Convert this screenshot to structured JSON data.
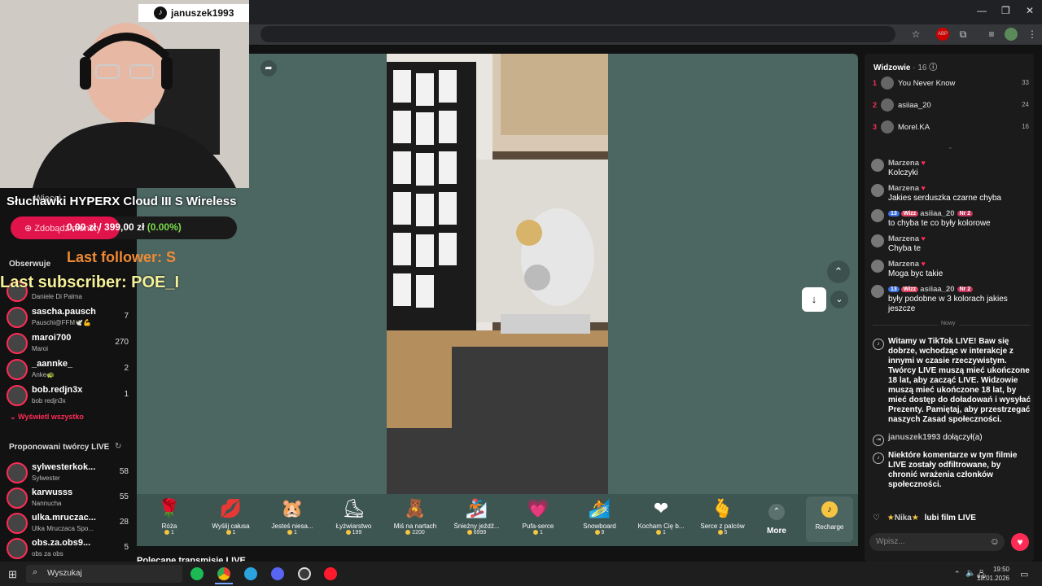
{
  "overlay": {
    "webcam_handle": "januszek1993",
    "product_title": "Słuchawki HYPERX Cloud III S Wireless",
    "goal_text": "0,00 zł / 399,00 zł",
    "goal_percent": "(0.00%)",
    "goal_progress": 0,
    "button_behind": "Zdobądź monety",
    "back_text": "Więcej",
    "last_follower": "Last follower: S",
    "last_subscriber": "Last subscriber: POE_I"
  },
  "sidebar": {
    "following_title": "Obserwuje",
    "following": [
      {
        "name": "",
        "sub": "Daniele Di Palma",
        "count": ""
      },
      {
        "name": "sascha.pausch",
        "sub": "Pauschi@FFM🕊️💪",
        "count": "7"
      },
      {
        "name": "maroi700",
        "sub": "Maroi",
        "count": "270"
      },
      {
        "name": "_aannke_",
        "sub": "Anke🐢",
        "count": "2"
      },
      {
        "name": "bob.redjn3x",
        "sub": "bob redjn3x",
        "count": "1"
      }
    ],
    "show_all": "Wyświetl wszystko",
    "suggested_title": "Proponowani twórcy LIVE",
    "suggested": [
      {
        "name": "sylwesterkok...",
        "sub": "Sylwester",
        "count": "58"
      },
      {
        "name": "karwusss",
        "sub": "Nannucha",
        "count": "55"
      },
      {
        "name": "ulka.mruczac...",
        "sub": "Ulka Mruczaca Spo...",
        "count": "28"
      },
      {
        "name": "obs.za.obs9...",
        "sub": "obs za obs",
        "count": "5"
      }
    ]
  },
  "gifts": [
    {
      "name": "Róża",
      "price": "1",
      "icon": "🌹"
    },
    {
      "name": "Wyślij całusa",
      "price": "1",
      "icon": "💋"
    },
    {
      "name": "Jesteś niesa...",
      "price": "1",
      "icon": "🐹"
    },
    {
      "name": "Łyżwiarstwo",
      "price": "199",
      "icon": "⛸"
    },
    {
      "name": "Miś na nartach",
      "price": "2200",
      "icon": "🧸"
    },
    {
      "name": "Śnieżny jeźdź...",
      "price": "6999",
      "icon": "🏂"
    },
    {
      "name": "Pufa-serce",
      "price": "1",
      "icon": "💗"
    },
    {
      "name": "Snowboard",
      "price": "9",
      "icon": "🏄"
    },
    {
      "name": "Kocham Cię b...",
      "price": "1",
      "icon": "❤"
    },
    {
      "name": "Serce z palców",
      "price": "5",
      "icon": "🫰"
    }
  ],
  "more_label": "More",
  "recharge_label": "Recharge",
  "recommended": "Polecane transmisje LIVE",
  "chat": {
    "viewers_label": "Widzowie",
    "viewers_count": "· 16",
    "viewers": [
      {
        "rank": "1",
        "name": "You Never Know",
        "score": "33"
      },
      {
        "rank": "2",
        "name": "asiiaa_20",
        "score": "24"
      },
      {
        "rank": "3",
        "name": "Morel.KA",
        "score": "16"
      }
    ],
    "messages": [
      {
        "user": "Marzena",
        "text": "Kolczyki",
        "badges": false
      },
      {
        "user": "Marzena",
        "text": "Jakies serduszka czarne chyba",
        "badges": false
      },
      {
        "user": "asiiaa_20",
        "text": "to chyba te co były kolorowe",
        "badges": true
      },
      {
        "user": "Marzena",
        "text": "Chyba te",
        "badges": false
      },
      {
        "user": "Marzena",
        "text": "Moga byc takie",
        "badges": false
      },
      {
        "user": "asiiaa_20",
        "text": "były podobne w 3 kolorach jakies jeszcze",
        "badges": true
      }
    ],
    "badge_level": "13",
    "badge_wizz": "Wizz",
    "badge_nr": "Nr 2",
    "new_divider": "Nowy",
    "system_welcome": "Witamy w TikTok LIVE! Baw się dobrze, wchodząc w interakcje z innymi w czasie rzeczywistym. Twórcy LIVE muszą mieć ukończone 18 lat, aby zacząć LIVE. Widzowie muszą mieć ukończone 18 lat, by mieć dostęp do doładowań i wysyłać Prezenty. Pamiętaj, aby przestrzegać naszych Zasad społeczności.",
    "joined_user": "januszek1993",
    "joined_text": "dołączył(a)",
    "system_filtered": "Niektóre komentarze w tym filmie LIVE zostały odfiltrowane, by chronić wrażenia członków społeczności.",
    "bottom_name": "Nika",
    "bottom_text": "lubi film LIVE",
    "input_placeholder": "Wpisz..."
  },
  "taskbar": {
    "search": "Wyszukaj",
    "time": "19:50",
    "date": "18.01.2026"
  },
  "colors": {
    "accent": "#fe2c55",
    "stage": "#4c6661"
  }
}
